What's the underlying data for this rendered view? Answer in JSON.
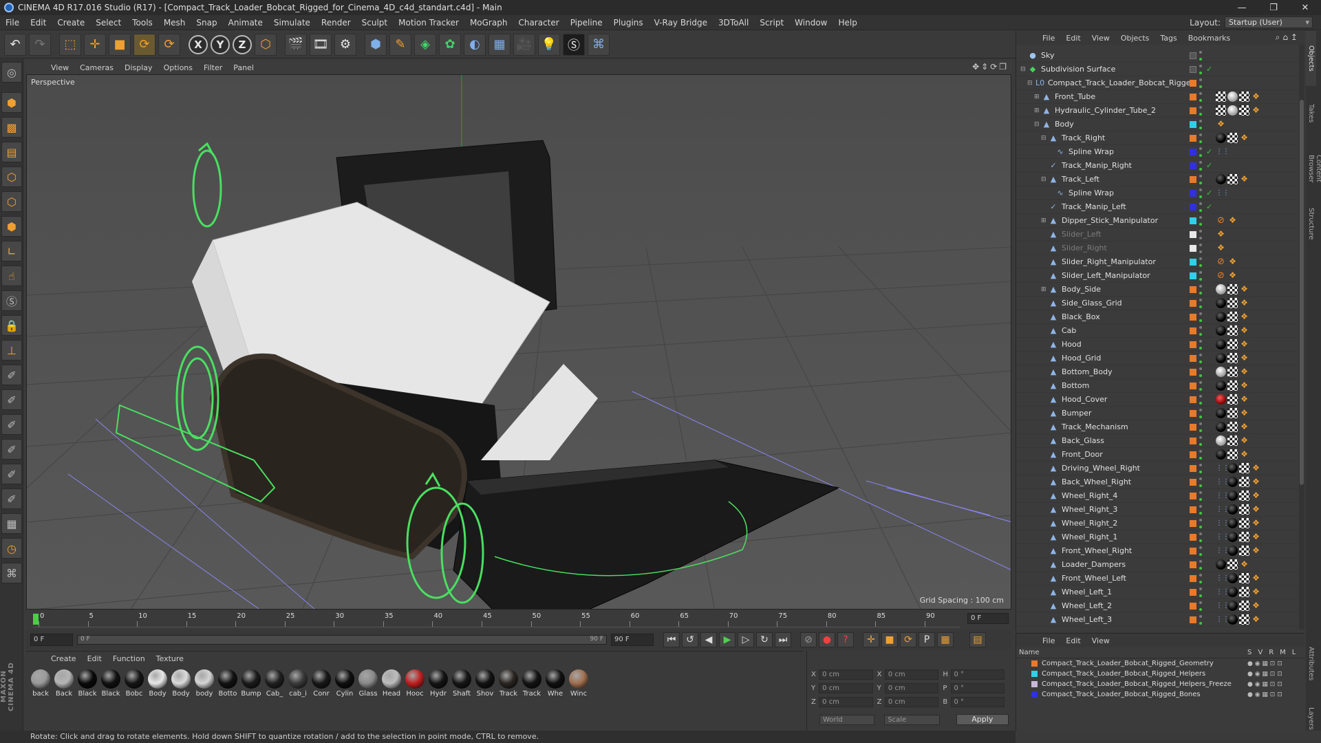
{
  "window": {
    "title": "CINEMA 4D R17.016 Studio (R17) - [Compact_Track_Loader_Bobcat_Rigged_for_Cinema_4D_c4d_standart.c4d] - Main",
    "controls": [
      "—",
      "❐",
      "✕"
    ]
  },
  "menu": [
    "File",
    "Edit",
    "Create",
    "Select",
    "Tools",
    "Mesh",
    "Snap",
    "Animate",
    "Simulate",
    "Render",
    "Sculpt",
    "Motion Tracker",
    "MoGraph",
    "Character",
    "Pipeline",
    "Plugins",
    "V-Ray Bridge",
    "3DToAll",
    "Script",
    "Window",
    "Help"
  ],
  "layout": {
    "label": "Layout:",
    "value": "Startup (User)"
  },
  "toolbar": {
    "icons": [
      "undo-icon",
      "redo-icon",
      "live-select-icon",
      "move-icon",
      "scale-icon",
      "rotate-icon",
      "recent-tools-icon",
      "x-axis-icon",
      "y-axis-icon",
      "z-axis-icon",
      "coordinate-system-icon",
      "render-view-icon",
      "render-picture-viewer-icon",
      "edit-render-settings-icon",
      "cube-icon",
      "pen-spline-icon",
      "subdivision-surface-icon",
      "array-icon",
      "deformer-icon",
      "floor-icon",
      "camera-icon",
      "light-icon",
      "vray-icon",
      "python-icon"
    ],
    "axis_labels": [
      "X",
      "Y",
      "Z"
    ]
  },
  "viewport": {
    "menu": [
      "View",
      "Cameras",
      "Display",
      "Options",
      "Filter",
      "Panel"
    ],
    "label": "Perspective",
    "grid_spacing": "Grid Spacing : 100 cm",
    "nav_icons": "✥⇕⟳❐"
  },
  "timeline": {
    "ticks": [
      "0",
      "5",
      "10",
      "15",
      "20",
      "25",
      "30",
      "35",
      "40",
      "45",
      "50",
      "55",
      "60",
      "65",
      "70",
      "75",
      "80",
      "85",
      "90"
    ],
    "current_frame": "0 F",
    "end_field": "0 F",
    "start": "0 F",
    "range_start": "0 F",
    "range_end": "90 F",
    "end": "90 F"
  },
  "materials": {
    "menu": [
      "Create",
      "Edit",
      "Function",
      "Texture"
    ],
    "items": [
      {
        "label": "back",
        "color": "#9a9a9a"
      },
      {
        "label": "Back",
        "color": "#b5b5b5"
      },
      {
        "label": "Black",
        "color": "#0a0a0a"
      },
      {
        "label": "Black",
        "color": "#111111"
      },
      {
        "label": "Bobc",
        "color": "#151515"
      },
      {
        "label": "Body",
        "color": "#e8e8e8"
      },
      {
        "label": "Body",
        "color": "#dcdcdc"
      },
      {
        "label": "body",
        "color": "#d4d4d4"
      },
      {
        "label": "Botto",
        "color": "#121212"
      },
      {
        "label": "Bump",
        "color": "#1a1a1a"
      },
      {
        "label": "Cab_",
        "color": "#202020"
      },
      {
        "label": "cab_i",
        "color": "#3a3a3a"
      },
      {
        "label": "Conr",
        "color": "#181818"
      },
      {
        "label": "Cylin",
        "color": "#0e0e0e"
      },
      {
        "label": "Glass",
        "color": "#8a8a8a"
      },
      {
        "label": "Head",
        "color": "#bdbdbd"
      },
      {
        "label": "Hooc",
        "color": "#c02020"
      },
      {
        "label": "Hydr",
        "color": "#141414"
      },
      {
        "label": "Shaft",
        "color": "#161616"
      },
      {
        "label": "Shov",
        "color": "#121212"
      },
      {
        "label": "Track",
        "color": "#2a2522"
      },
      {
        "label": "Track",
        "color": "#131313"
      },
      {
        "label": "Whe",
        "color": "#101010"
      },
      {
        "label": "Winc",
        "color": "#a07050"
      }
    ]
  },
  "coords": {
    "rows": [
      {
        "a": "X",
        "av": "0 cm",
        "b": "X",
        "bv": "0 cm",
        "c": "H",
        "cv": "0 °"
      },
      {
        "a": "Y",
        "av": "0 cm",
        "b": "Y",
        "bv": "0 cm",
        "c": "P",
        "cv": "0 °"
      },
      {
        "a": "Z",
        "av": "0 cm",
        "b": "Z",
        "bv": "0 cm",
        "c": "B",
        "cv": "0 °"
      }
    ],
    "mode1": "World",
    "mode2": "Scale",
    "apply": "Apply"
  },
  "status": "Rotate: Click and drag to rotate elements. Hold down SHIFT to quantize rotation / add to the selection in point mode, CTRL to remove.",
  "objects": {
    "menu": [
      "File",
      "Edit",
      "View",
      "Objects",
      "Tags",
      "Bookmarks"
    ],
    "rows": [
      {
        "name": "Sky",
        "indent": 0,
        "icon": "sky-icon",
        "glyph": "●",
        "layer": "",
        "tags": [],
        "check": false,
        "dim": false,
        "expander": ""
      },
      {
        "name": "Subdivision Surface",
        "indent": 0,
        "icon": "subdivision-surface-icon",
        "glyph": "◆",
        "layer": "",
        "tags": [],
        "check": true,
        "dim": false,
        "expander": "⊟"
      },
      {
        "name": "Compact_Track_Loader_Bobcat_Rigged",
        "indent": 1,
        "icon": "null-icon",
        "glyph": "L0",
        "layer": "#e87a2a",
        "tags": [],
        "check": false,
        "dim": false,
        "expander": "⊟"
      },
      {
        "name": "Front_Tube",
        "indent": 2,
        "icon": "polygon-object-icon",
        "glyph": "▲",
        "layer": "#e87a2a",
        "tags": [
          "checker",
          "white",
          "checker",
          "orange"
        ],
        "check": false,
        "dim": false,
        "expander": "⊞"
      },
      {
        "name": "Hydraulic_Cylinder_Tube_2",
        "indent": 2,
        "icon": "polygon-object-icon",
        "glyph": "▲",
        "layer": "#e87a2a",
        "tags": [
          "checker",
          "white",
          "checker",
          "orange"
        ],
        "check": false,
        "dim": false,
        "expander": "⊞"
      },
      {
        "name": "Body",
        "indent": 2,
        "icon": "polygon-object-icon",
        "glyph": "▲",
        "layer": "#2fd0e8",
        "tags": [
          "orange"
        ],
        "check": false,
        "dim": false,
        "expander": "⊟"
      },
      {
        "name": "Track_Right",
        "indent": 3,
        "icon": "polygon-object-icon",
        "glyph": "▲",
        "layer": "#e87a2a",
        "tags": [
          "black",
          "checker",
          "orange"
        ],
        "check": false,
        "dim": false,
        "expander": "⊟"
      },
      {
        "name": "Spline Wrap",
        "indent": 4,
        "icon": "spline-wrap-icon",
        "glyph": "∿",
        "layer": "#3030e0",
        "tags": [
          "bluedots"
        ],
        "check": true,
        "dim": false,
        "expander": ""
      },
      {
        "name": "Track_Manip_Right",
        "indent": 3,
        "icon": "spline-icon",
        "glyph": "✓",
        "layer": "#3030e0",
        "tags": [],
        "check": true,
        "dim": false,
        "expander": ""
      },
      {
        "name": "Track_Left",
        "indent": 3,
        "icon": "polygon-object-icon",
        "glyph": "▲",
        "layer": "#e87a2a",
        "tags": [
          "black",
          "checker",
          "orange"
        ],
        "check": false,
        "dim": false,
        "expander": "⊟"
      },
      {
        "name": "Spline Wrap",
        "indent": 4,
        "icon": "spline-wrap-icon",
        "glyph": "∿",
        "layer": "#3030e0",
        "tags": [
          "bluedots"
        ],
        "check": true,
        "dim": false,
        "expander": ""
      },
      {
        "name": "Track_Manip_Left",
        "indent": 3,
        "icon": "spline-icon",
        "glyph": "✓",
        "layer": "#3030e0",
        "tags": [],
        "check": true,
        "dim": false,
        "expander": ""
      },
      {
        "name": "Dipper_Stick_Manipulator",
        "indent": 3,
        "icon": "polygon-object-icon",
        "glyph": "▲",
        "layer": "#2fd0e8",
        "tags": [
          "stop",
          "orange"
        ],
        "check": false,
        "dim": false,
        "expander": "⊞"
      },
      {
        "name": "Slider_Left",
        "indent": 3,
        "icon": "polygon-object-icon",
        "glyph": "▲",
        "layer": "#e8e8e8",
        "tags": [
          "orange"
        ],
        "check": false,
        "dim": true,
        "expander": ""
      },
      {
        "name": "Slider_Right",
        "indent": 3,
        "icon": "polygon-object-icon",
        "glyph": "▲",
        "layer": "#e8e8e8",
        "tags": [
          "orange"
        ],
        "check": false,
        "dim": true,
        "expander": ""
      },
      {
        "name": "Slider_Right_Manipulator",
        "indent": 3,
        "icon": "polygon-object-icon",
        "glyph": "▲",
        "layer": "#2fd0e8",
        "tags": [
          "stop",
          "orange"
        ],
        "check": false,
        "dim": false,
        "expander": ""
      },
      {
        "name": "Slider_Left_Manipulator",
        "indent": 3,
        "icon": "polygon-object-icon",
        "glyph": "▲",
        "layer": "#2fd0e8",
        "tags": [
          "stop",
          "orange"
        ],
        "check": false,
        "dim": false,
        "expander": ""
      },
      {
        "name": "Body_Side",
        "indent": 3,
        "icon": "polygon-object-icon",
        "glyph": "▲",
        "layer": "#e87a2a",
        "tags": [
          "white",
          "checker",
          "orange"
        ],
        "check": false,
        "dim": false,
        "expander": "⊞"
      },
      {
        "name": "Side_Glass_Grid",
        "indent": 3,
        "icon": "polygon-object-icon",
        "glyph": "▲",
        "layer": "#e87a2a",
        "tags": [
          "black",
          "checker",
          "orange"
        ],
        "check": false,
        "dim": false,
        "expander": ""
      },
      {
        "name": "Black_Box",
        "indent": 3,
        "icon": "polygon-object-icon",
        "glyph": "▲",
        "layer": "#e87a2a",
        "tags": [
          "black",
          "checker",
          "orange"
        ],
        "check": false,
        "dim": false,
        "expander": ""
      },
      {
        "name": "Cab",
        "indent": 3,
        "icon": "polygon-object-icon",
        "glyph": "▲",
        "layer": "#e87a2a",
        "tags": [
          "black",
          "checker",
          "orange"
        ],
        "check": false,
        "dim": false,
        "expander": ""
      },
      {
        "name": "Hood",
        "indent": 3,
        "icon": "polygon-object-icon",
        "glyph": "▲",
        "layer": "#e87a2a",
        "tags": [
          "black",
          "checker",
          "orange"
        ],
        "check": false,
        "dim": false,
        "expander": ""
      },
      {
        "name": "Hood_Grid",
        "indent": 3,
        "icon": "polygon-object-icon",
        "glyph": "▲",
        "layer": "#e87a2a",
        "tags": [
          "black",
          "checker",
          "orange"
        ],
        "check": false,
        "dim": false,
        "expander": ""
      },
      {
        "name": "Bottom_Body",
        "indent": 3,
        "icon": "polygon-object-icon",
        "glyph": "▲",
        "layer": "#e87a2a",
        "tags": [
          "white",
          "checker",
          "orange"
        ],
        "check": false,
        "dim": false,
        "expander": ""
      },
      {
        "name": "Bottom",
        "indent": 3,
        "icon": "polygon-object-icon",
        "glyph": "▲",
        "layer": "#e87a2a",
        "tags": [
          "black",
          "checker",
          "orange"
        ],
        "check": false,
        "dim": false,
        "expander": ""
      },
      {
        "name": "Hood_Cover",
        "indent": 3,
        "icon": "polygon-object-icon",
        "glyph": "▲",
        "layer": "#e87a2a",
        "tags": [
          "red",
          "checker",
          "orange"
        ],
        "check": false,
        "dim": false,
        "expander": ""
      },
      {
        "name": "Bumper",
        "indent": 3,
        "icon": "polygon-object-icon",
        "glyph": "▲",
        "layer": "#e87a2a",
        "tags": [
          "black",
          "checker",
          "orange"
        ],
        "check": false,
        "dim": false,
        "expander": ""
      },
      {
        "name": "Track_Mechanism",
        "indent": 3,
        "icon": "polygon-object-icon",
        "glyph": "▲",
        "layer": "#e87a2a",
        "tags": [
          "black",
          "checker",
          "orange"
        ],
        "check": false,
        "dim": false,
        "expander": ""
      },
      {
        "name": "Back_Glass",
        "indent": 3,
        "icon": "polygon-object-icon",
        "glyph": "▲",
        "layer": "#e87a2a",
        "tags": [
          "white",
          "checker",
          "orange"
        ],
        "check": false,
        "dim": false,
        "expander": ""
      },
      {
        "name": "Front_Door",
        "indent": 3,
        "icon": "polygon-object-icon",
        "glyph": "▲",
        "layer": "#e87a2a",
        "tags": [
          "black",
          "checker",
          "orange"
        ],
        "check": false,
        "dim": false,
        "expander": ""
      },
      {
        "name": "Driving_Wheel_Right",
        "indent": 3,
        "icon": "polygon-object-icon",
        "glyph": "▲",
        "layer": "#e87a2a",
        "tags": [
          "bluedots",
          "black",
          "checker",
          "orange"
        ],
        "check": false,
        "dim": false,
        "expander": ""
      },
      {
        "name": "Back_Wheel_Right",
        "indent": 3,
        "icon": "polygon-object-icon",
        "glyph": "▲",
        "layer": "#e87a2a",
        "tags": [
          "bluedots",
          "black",
          "checker",
          "orange"
        ],
        "check": false,
        "dim": false,
        "expander": ""
      },
      {
        "name": "Wheel_Right_4",
        "indent": 3,
        "icon": "polygon-object-icon",
        "glyph": "▲",
        "layer": "#e87a2a",
        "tags": [
          "bluedots",
          "black",
          "checker",
          "orange"
        ],
        "check": false,
        "dim": false,
        "expander": ""
      },
      {
        "name": "Wheel_Right_3",
        "indent": 3,
        "icon": "polygon-object-icon",
        "glyph": "▲",
        "layer": "#e87a2a",
        "tags": [
          "bluedots",
          "black",
          "checker",
          "orange"
        ],
        "check": false,
        "dim": false,
        "expander": ""
      },
      {
        "name": "Wheel_Right_2",
        "indent": 3,
        "icon": "polygon-object-icon",
        "glyph": "▲",
        "layer": "#e87a2a",
        "tags": [
          "bluedots",
          "black",
          "checker",
          "orange"
        ],
        "check": false,
        "dim": false,
        "expander": ""
      },
      {
        "name": "Wheel_Right_1",
        "indent": 3,
        "icon": "polygon-object-icon",
        "glyph": "▲",
        "layer": "#e87a2a",
        "tags": [
          "bluedots",
          "black",
          "checker",
          "orange"
        ],
        "check": false,
        "dim": false,
        "expander": ""
      },
      {
        "name": "Front_Wheel_Right",
        "indent": 3,
        "icon": "polygon-object-icon",
        "glyph": "▲",
        "layer": "#e87a2a",
        "tags": [
          "bluedots",
          "black",
          "checker",
          "orange"
        ],
        "check": false,
        "dim": false,
        "expander": ""
      },
      {
        "name": "Loader_Dampers",
        "indent": 3,
        "icon": "polygon-object-icon",
        "glyph": "▲",
        "layer": "#e87a2a",
        "tags": [
          "black",
          "checker",
          "orange"
        ],
        "check": false,
        "dim": false,
        "expander": ""
      },
      {
        "name": "Front_Wheel_Left",
        "indent": 3,
        "icon": "polygon-object-icon",
        "glyph": "▲",
        "layer": "#e87a2a",
        "tags": [
          "bluedots",
          "black",
          "checker",
          "orange"
        ],
        "check": false,
        "dim": false,
        "expander": ""
      },
      {
        "name": "Wheel_Left_1",
        "indent": 3,
        "icon": "polygon-object-icon",
        "glyph": "▲",
        "layer": "#e87a2a",
        "tags": [
          "bluedots",
          "black",
          "checker",
          "orange"
        ],
        "check": false,
        "dim": false,
        "expander": ""
      },
      {
        "name": "Wheel_Left_2",
        "indent": 3,
        "icon": "polygon-object-icon",
        "glyph": "▲",
        "layer": "#e87a2a",
        "tags": [
          "bluedots",
          "black",
          "checker",
          "orange"
        ],
        "check": false,
        "dim": false,
        "expander": ""
      },
      {
        "name": "Wheel_Left_3",
        "indent": 3,
        "icon": "polygon-object-icon",
        "glyph": "▲",
        "layer": "#e87a2a",
        "tags": [
          "bluedots",
          "black",
          "checker",
          "orange"
        ],
        "check": false,
        "dim": false,
        "expander": ""
      }
    ]
  },
  "right_tabs": [
    "Objects",
    "Takes",
    "Content Browser",
    "Structure",
    "Attributes",
    "Layers"
  ],
  "layers": {
    "menu": [
      "File",
      "Edit",
      "View"
    ],
    "header": "Name",
    "columns": [
      "S",
      "V",
      "R",
      "M",
      "L"
    ],
    "rows": [
      {
        "name": "Compact_Track_Loader_Bobcat_Rigged_Geometry",
        "color": "#e87a2a"
      },
      {
        "name": "Compact_Track_Loader_Bobcat_Rigged_Helpers",
        "color": "#2fd0e8"
      },
      {
        "name": "Compact_Track_Loader_Bobcat_Rigged_Helpers_Freeze",
        "color": "#c8b8d8"
      },
      {
        "name": "Compact_Track_Loader_Bobcat_Rigged_Bones",
        "color": "#3030e0"
      }
    ]
  }
}
